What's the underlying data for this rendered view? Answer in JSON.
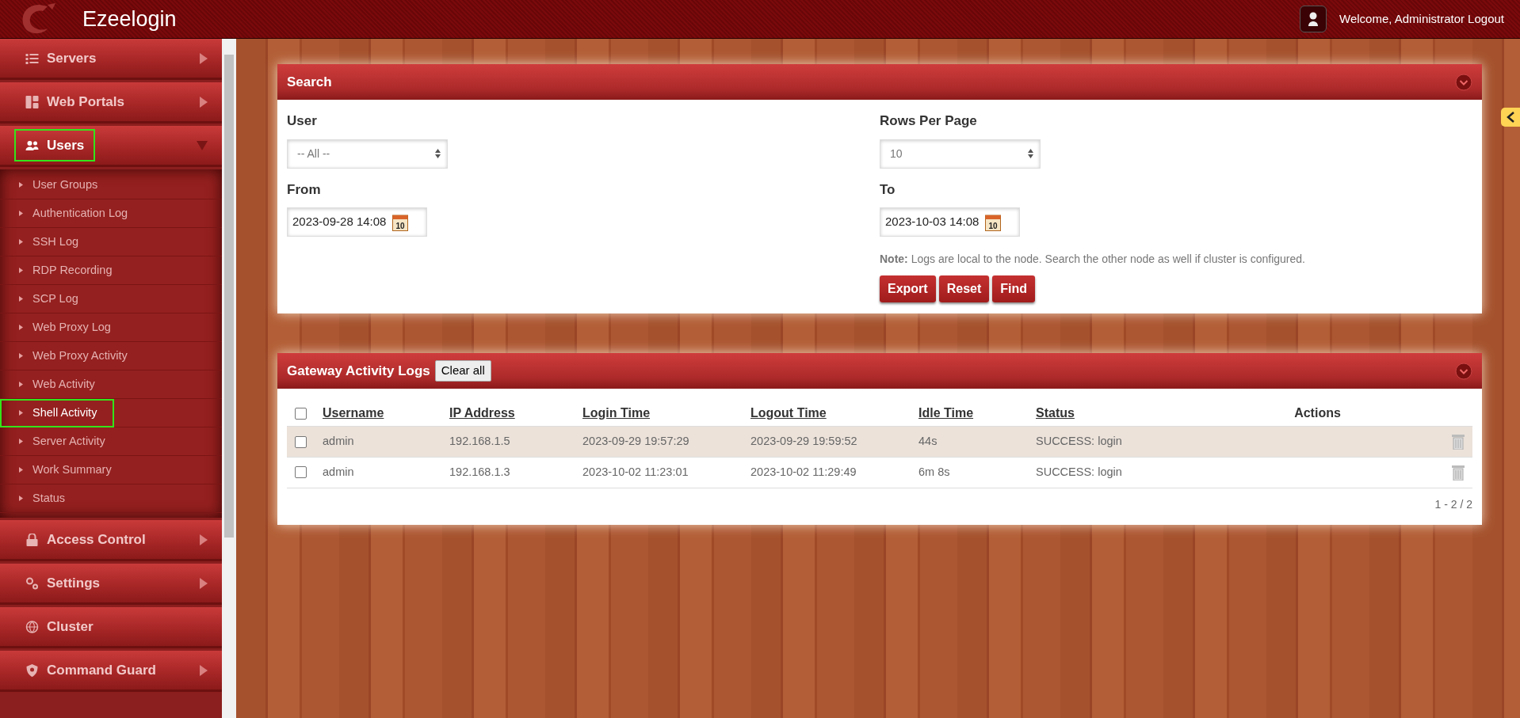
{
  "header": {
    "brand": "Ezeelogin",
    "welcome": "Welcome, Administrator",
    "logout": "Logout"
  },
  "sidebar": {
    "items": [
      {
        "label": "Servers",
        "expanded": false,
        "highlighted": false
      },
      {
        "label": "Web Portals",
        "expanded": false,
        "highlighted": false
      },
      {
        "label": "Users",
        "expanded": true,
        "highlighted": true,
        "children": [
          {
            "label": "User Groups",
            "selected": false,
            "highlighted": false
          },
          {
            "label": "Authentication Log",
            "selected": false,
            "highlighted": false
          },
          {
            "label": "SSH Log",
            "selected": false,
            "highlighted": false
          },
          {
            "label": "RDP Recording",
            "selected": false,
            "highlighted": false
          },
          {
            "label": "SCP Log",
            "selected": false,
            "highlighted": false
          },
          {
            "label": "Web Proxy Log",
            "selected": false,
            "highlighted": false
          },
          {
            "label": "Web Proxy Activity",
            "selected": false,
            "highlighted": false
          },
          {
            "label": "Web Activity",
            "selected": false,
            "highlighted": false
          },
          {
            "label": "Shell Activity",
            "selected": true,
            "highlighted": true
          },
          {
            "label": "Server Activity",
            "selected": false,
            "highlighted": false
          },
          {
            "label": "Work Summary",
            "selected": false,
            "highlighted": false
          },
          {
            "label": "Status",
            "selected": false,
            "highlighted": false
          }
        ]
      },
      {
        "label": "Access Control",
        "expanded": false,
        "highlighted": false
      },
      {
        "label": "Settings",
        "expanded": false,
        "highlighted": false
      },
      {
        "label": "Cluster",
        "highlighted": false
      },
      {
        "label": "Command Guard",
        "expanded": false,
        "highlighted": false
      }
    ]
  },
  "search": {
    "title": "Search",
    "user": {
      "label": "User",
      "value": "-- All --"
    },
    "rows_per_page": {
      "label": "Rows Per Page",
      "value": "10"
    },
    "from": {
      "label": "From",
      "value": "2023-09-28 14:08",
      "calendar_day": "10"
    },
    "to": {
      "label": "To",
      "value": "2023-10-03 14:08",
      "calendar_day": "10"
    },
    "note": "**Note:** Logs are local to the node. Search the other node as well if cluster is configured.",
    "buttons": [
      "Export",
      "Reset",
      "Find"
    ]
  },
  "logs": {
    "title": "Gateway Activity Logs",
    "clear_button": "Clear all",
    "select_all_checked": false,
    "columns": [
      "Username",
      "IP Address",
      "Login Time",
      "Logout Time",
      "Idle Time",
      "Status",
      "Actions"
    ],
    "rows": [
      {
        "checked": false,
        "highlighted": true,
        "cells": [
          "admin",
          "192.168.1.5",
          "2023-09-29 19:57:29",
          "2023-09-29 19:59:52",
          "44s",
          "SUCCESS: login"
        ]
      },
      {
        "checked": false,
        "highlighted": false,
        "cells": [
          "admin",
          "192.168.1.3",
          "2023-10-02 11:23:01",
          "2023-10-02 11:29:49",
          "6m 8s",
          "SUCCESS: login"
        ]
      }
    ],
    "pagination": "1 - 2 / 2"
  }
}
